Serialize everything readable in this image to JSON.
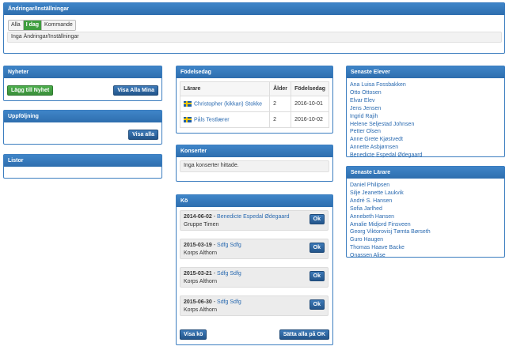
{
  "changes": {
    "title": "Ändringar/Inställningar",
    "tabs": [
      {
        "label": "Alla",
        "active": false
      },
      {
        "label": "I dag",
        "active": true
      },
      {
        "label": "Kommande",
        "active": false
      }
    ],
    "empty_text": "Inga Ändringar/Inställningar"
  },
  "news": {
    "title": "Nyheter",
    "add_label": "Lägg till Nyhet",
    "show_all_label": "Visa Alla Mina"
  },
  "followup": {
    "title": "Uppföljning",
    "show_all_label": "Visa alla"
  },
  "lists": {
    "title": "Listor"
  },
  "birthdays": {
    "title": "Födelsedag",
    "columns": [
      "Lärare",
      "Ålder",
      "Födelsedag"
    ],
    "rows": [
      {
        "name": "Christopher (kikkan) Stokke",
        "age": "2",
        "date": "2016-10-01"
      },
      {
        "name": "Påls Testlærer",
        "age": "2",
        "date": "2016-10-02"
      }
    ]
  },
  "concerts": {
    "title": "Konserter",
    "empty_text": "Inga konserter hittade."
  },
  "queue": {
    "title": "Kö",
    "items": [
      {
        "date": "2014-06-02",
        "sep": " - ",
        "name": "Benedicte Espedal Ødegaard",
        "group": "Gruppe Timen",
        "ok": "Ok"
      },
      {
        "date": "2015-03-19",
        "sep": " - ",
        "name": "Sdfg Sdfg",
        "group": "Korps Althorn",
        "ok": "Ok"
      },
      {
        "date": "2015-03-21",
        "sep": " - ",
        "name": "Sdfg Sdfg",
        "group": "Korps Althorn",
        "ok": "Ok"
      },
      {
        "date": "2015-06-30",
        "sep": " - ",
        "name": "Sdfg Sdfg",
        "group": "Korps Althorn",
        "ok": "Ok"
      }
    ],
    "show_queue_label": "Visa kö",
    "set_all_ok_label": "Sätta alla på OK"
  },
  "latest_students": {
    "title": "Senaste Elever",
    "items": [
      "Ana Luisa Fossbakken",
      "Otto Ottosen",
      "Elvar Elev",
      "Jens Jensen",
      "Ingrid Rajih",
      "Helene Seljestad Johnsen",
      "Petter Olsen",
      "Anne Grete Kjøstvedt",
      "Annette Asbjørnsen",
      "Benedicte Espedal Ødegaard"
    ]
  },
  "latest_teachers": {
    "title": "Senaste Lärare",
    "items": [
      "Daniel Philipsen",
      "Silje Jeanette Laukvik",
      "André S. Hansen",
      "Sofia Jarlhed",
      "Annebeth Hansen",
      "Amalie Midjord Finsveen",
      "Georg Viktorovisj Tømta Børseth",
      "Guro Haugen",
      "Thomas Haave Backe",
      "Onassen Alise"
    ]
  }
}
